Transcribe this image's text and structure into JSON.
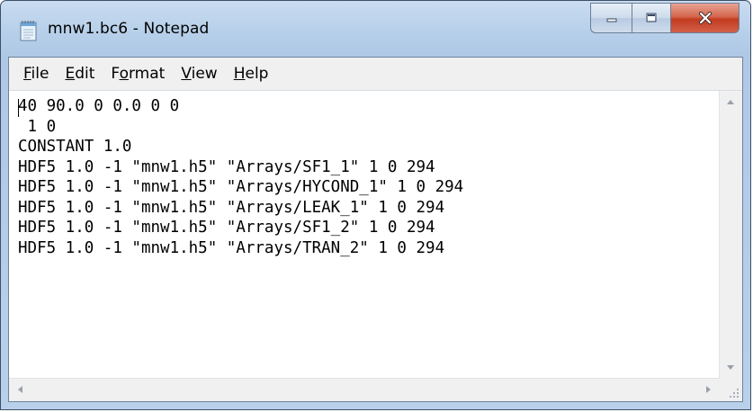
{
  "window": {
    "title": "mnw1.bc6 - Notepad",
    "icon": "notepad-icon",
    "caption_buttons": {
      "minimize_icon": "minimize-icon",
      "maximize_icon": "maximize-icon",
      "close_icon": "close-icon",
      "close_color": "#c7402a"
    }
  },
  "menu": {
    "items": [
      {
        "pre": "",
        "accel": "F",
        "post": "ile"
      },
      {
        "pre": "",
        "accel": "E",
        "post": "dit"
      },
      {
        "pre": "F",
        "accel": "o",
        "post": "rmat"
      },
      {
        "pre": "",
        "accel": "V",
        "post": "iew"
      },
      {
        "pre": "",
        "accel": "H",
        "post": "elp"
      }
    ]
  },
  "editor": {
    "lines": [
      "40 90.0 0 0.0 0 0",
      " 1 0",
      "CONSTANT 1.0",
      "HDF5 1.0 -1 \"mnw1.h5\" \"Arrays/SF1_1\" 1 0 294",
      "HDF5 1.0 -1 \"mnw1.h5\" \"Arrays/HYCOND_1\" 1 0 294",
      "HDF5 1.0 -1 \"mnw1.h5\" \"Arrays/LEAK_1\" 1 0 294",
      "HDF5 1.0 -1 \"mnw1.h5\" \"Arrays/SF1_2\" 1 0 294",
      "HDF5 1.0 -1 \"mnw1.h5\" \"Arrays/TRAN_2\" 1 0 294"
    ]
  },
  "scrollbars": {
    "up_icon": "scroll-up-arrow-icon",
    "down_icon": "scroll-down-arrow-icon",
    "left_icon": "scroll-left-arrow-icon",
    "right_icon": "scroll-right-arrow-icon",
    "grip_icon": "size-grip-icon"
  }
}
